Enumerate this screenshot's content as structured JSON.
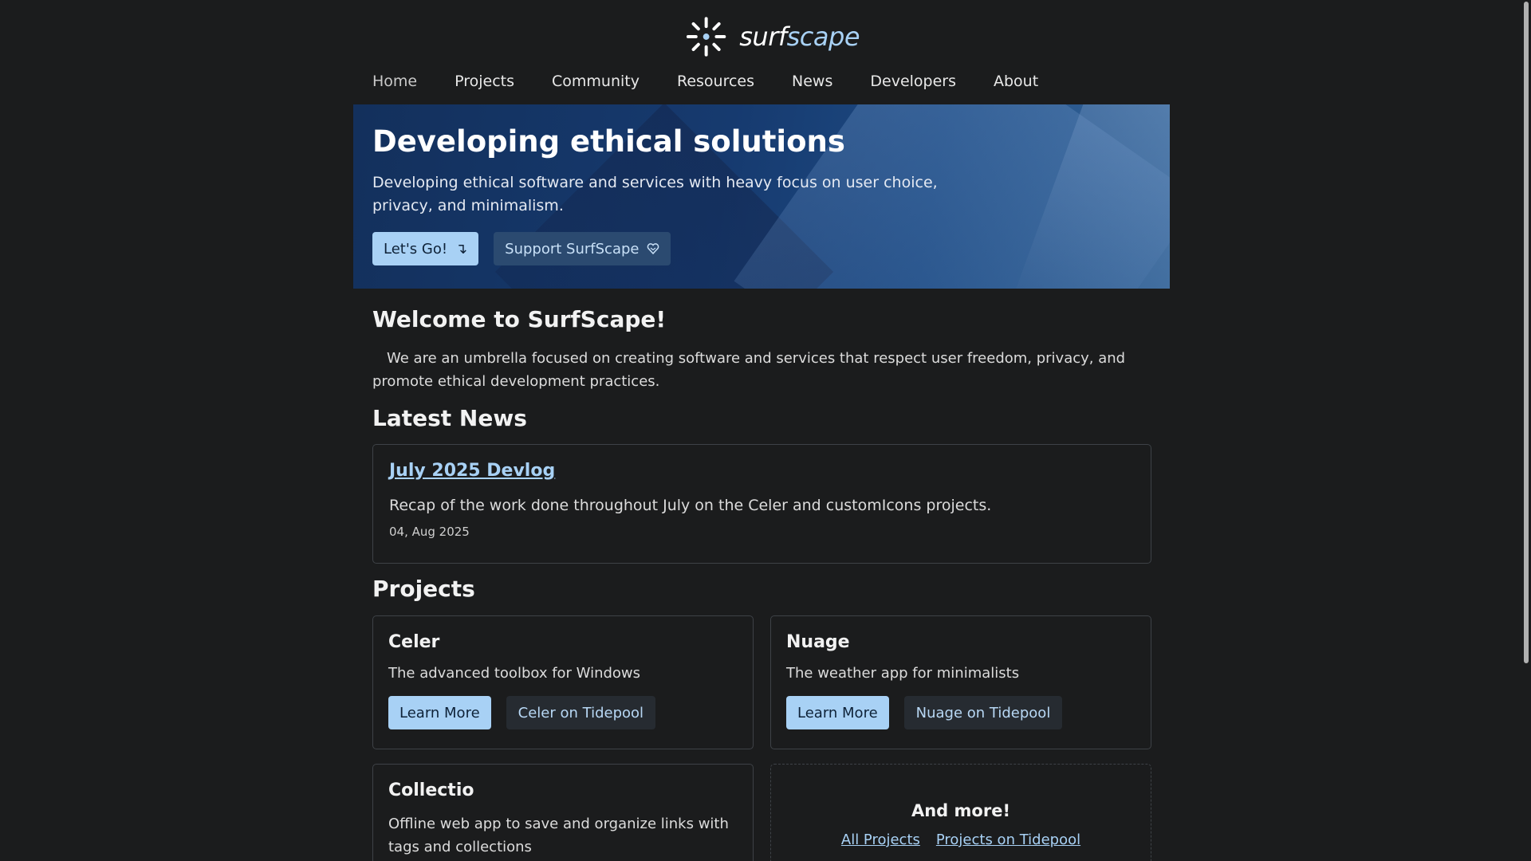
{
  "brand": {
    "logo_part1": "surf",
    "logo_part2": "scape",
    "icon": "sunburst-logo-icon"
  },
  "nav": {
    "items": [
      {
        "label": "Home"
      },
      {
        "label": "Projects"
      },
      {
        "label": "Community"
      },
      {
        "label": "Resources"
      },
      {
        "label": "News"
      },
      {
        "label": "Developers"
      },
      {
        "label": "About"
      }
    ]
  },
  "hero": {
    "title": "Developing ethical solutions",
    "subtitle": "Developing ethical software and services with heavy focus on user choice, privacy, and minimalism.",
    "primary_button": "Let's Go!",
    "primary_icon": "arrow-down-right-icon",
    "secondary_button": "Support SurfScape",
    "secondary_icon": "heart-icon"
  },
  "welcome": {
    "title": "Welcome to SurfScape!",
    "text": "We are an umbrella focused on creating software and services that respect user freedom, privacy, and promote ethical development practices."
  },
  "news": {
    "title": "Latest News",
    "items": [
      {
        "title": "July 2025 Devlog",
        "description": "Recap of the work done throughout July on the Celer and customIcons projects.",
        "date": "04, Aug 2025"
      }
    ]
  },
  "projects": {
    "title": "Projects",
    "items": [
      {
        "name": "Celer",
        "description": "The advanced toolbox for Windows",
        "learn_more": "Learn More",
        "tidepool": "Celer on Tidepool"
      },
      {
        "name": "Nuage",
        "description": "The weather app for minimalists",
        "learn_more": "Learn More",
        "tidepool": "Nuage on Tidepool"
      },
      {
        "name": "Collectio",
        "description": "Offline web app to save and organize links with tags and collections"
      }
    ],
    "more": {
      "title": "And more!",
      "all_projects": "All Projects",
      "tidepool": "Projects on Tidepool"
    }
  },
  "colors": {
    "background": "#1b1c1d",
    "accent": "#a8d1f5",
    "hero_blue": "#163a6f"
  }
}
